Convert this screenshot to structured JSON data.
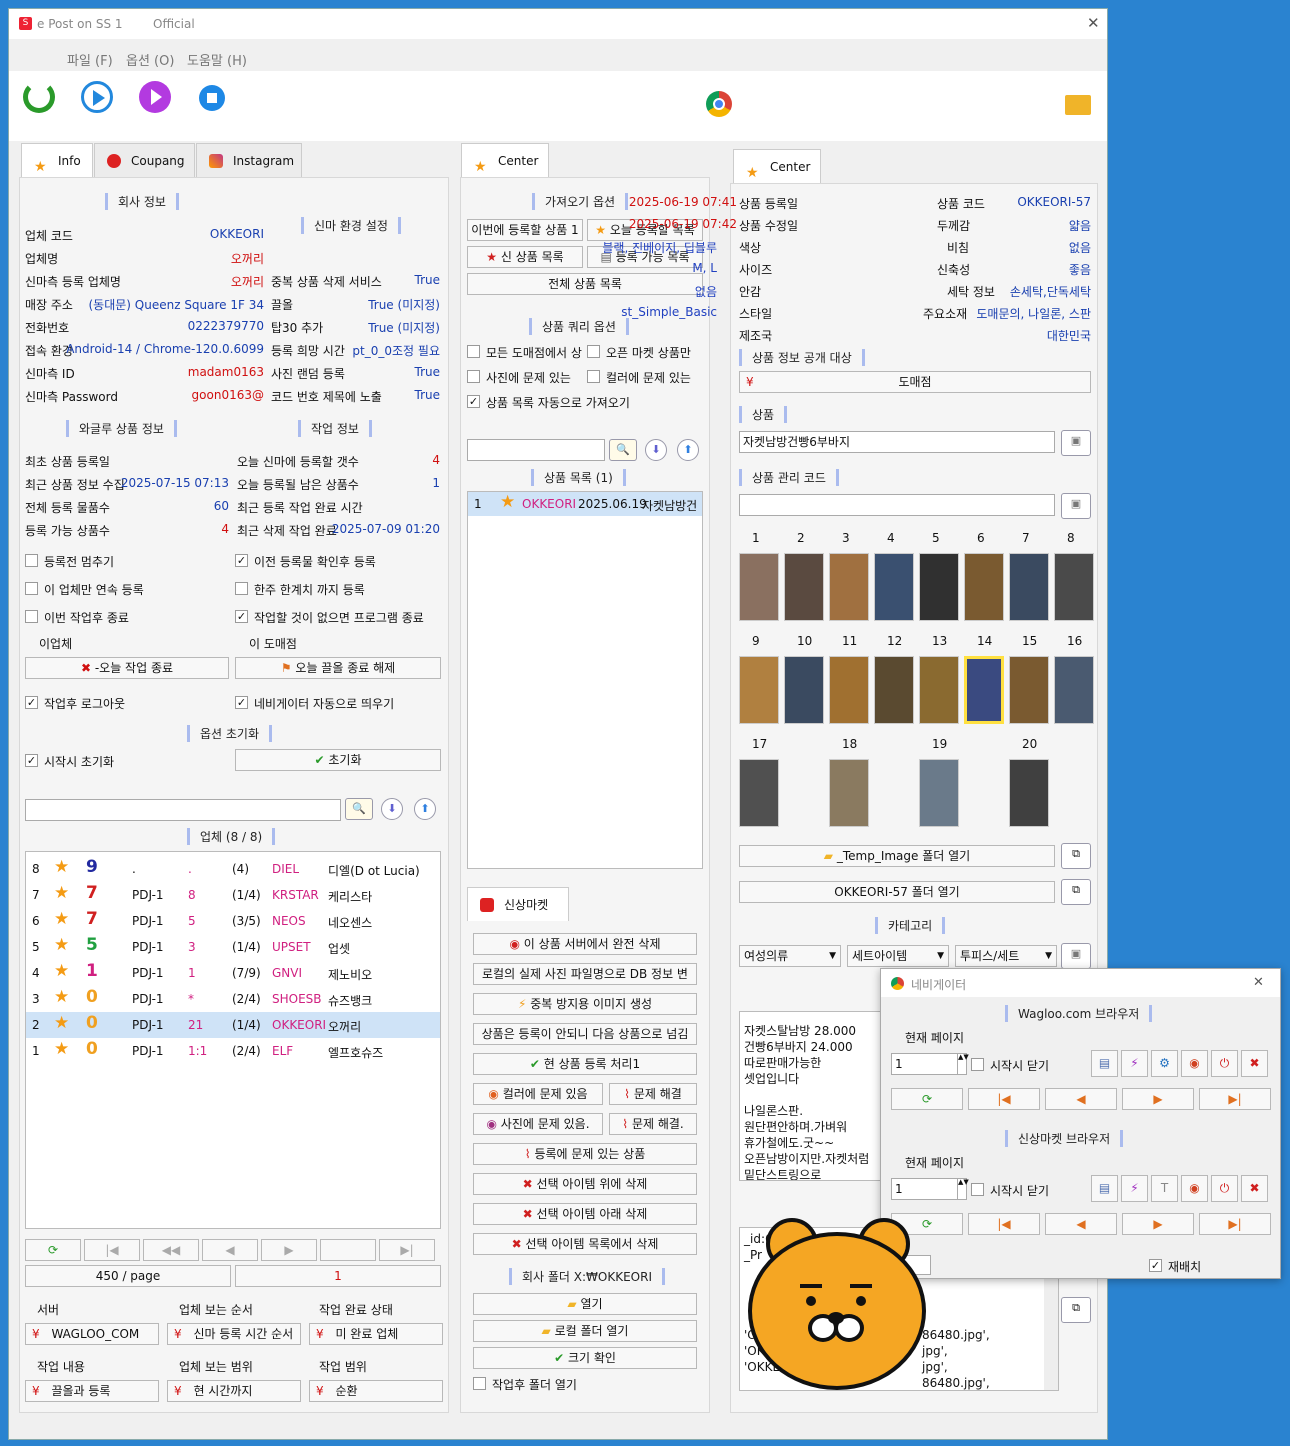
{
  "window": {
    "title": "e Post on SS 1",
    "subtitle": "Official"
  },
  "menu": [
    "파일 (F)",
    "옵션 (O)",
    "도움말 (H)"
  ],
  "tabs_left": [
    "Info",
    "Coupang",
    "Instagram"
  ],
  "company": {
    "header": "회사 정보",
    "rows": [
      {
        "k": "업체 코드",
        "v": "OKKEORI"
      },
      {
        "k": "업체명",
        "v": "오꺼리"
      },
      {
        "k": "신마측 등록 업체명",
        "v": "오꺼리"
      },
      {
        "k": "매장 주소",
        "v": "(동대문) Queenz Square 1F 34"
      },
      {
        "k": "전화번호",
        "v": "0222379770"
      },
      {
        "k": "접속 환경",
        "v": "Android-14 / Chrome-120.0.6099"
      },
      {
        "k": "신마측 ID",
        "v": "madam0163"
      },
      {
        "k": "신마측 Password",
        "v": "goon0163@"
      }
    ]
  },
  "env": {
    "header": "신마 환경 설정",
    "rows": [
      {
        "k": "중복 상품 삭제 서비스",
        "v": "True"
      },
      {
        "k": "끌올",
        "v": "True (미지정)"
      },
      {
        "k": "탑30 추가",
        "v": "True (미지정)"
      },
      {
        "k": "등록 희망 시간",
        "v": "pt_0_0조정 필요"
      },
      {
        "k": "사진 랜덤 등록",
        "v": "True"
      },
      {
        "k": "코드 번호 제목에 노출",
        "v": "True"
      }
    ]
  },
  "wagle": {
    "header": "와글루 상품 정보",
    "rows": [
      {
        "k": "최초 상품 등록일",
        "v": ""
      },
      {
        "k": "최근 상품 정보 수집",
        "v": "2025-07-15 07:13"
      },
      {
        "k": "전체 등록 물품수",
        "v": "60"
      },
      {
        "k": "등록 가능 상품수",
        "v": "4"
      }
    ]
  },
  "work": {
    "header": "작업 정보",
    "rows": [
      {
        "k": "오늘 신마에 등록할 갯수",
        "v": "4"
      },
      {
        "k": "오늘 등록될 남은 상품수",
        "v": "1"
      },
      {
        "k": "최근 등록 작업 완료 시간",
        "v": ""
      },
      {
        "k": "최근 삭제 작업 완료",
        "v": "2025-07-09 01:20"
      }
    ]
  },
  "opts": {
    "c1": "등록전 멈추기",
    "c2": "이전 등록물 확인후 등록",
    "c3": "이 업체만 연속 등록",
    "c4": "한주 한계치 까지 등록",
    "c5": "이번 작업후 종료",
    "c6": "작업할 것이 없으면 프로그램 종료",
    "l1": "이업체",
    "l2": "이 도매점",
    "b1": "-오늘 작업 종료",
    "b2": "오늘 끌올 종료 해제",
    "c7": "작업후 로그아웃",
    "c8": "네비게이터 자동으로 띄우기",
    "init_header": "옵션 초기화",
    "c9": "시작시 초기화",
    "b3": "초기화"
  },
  "vendors": {
    "header": "업체 (8 / 8)",
    "rows": [
      {
        "n": "8",
        "s": "9",
        "c": "#222aa0",
        "p": ".",
        "d": ".",
        "r": "(4)",
        "code": "DIEL",
        "name": "디엘(D ot Lucia)"
      },
      {
        "n": "7",
        "s": "7",
        "c": "#d02020",
        "p": "PDJ-1",
        "d": "8",
        "r": "(1/4)",
        "code": "KRSTAR",
        "name": "케리스타"
      },
      {
        "n": "6",
        "s": "7",
        "c": "#d02020",
        "p": "PDJ-1",
        "d": "5",
        "r": "(3/5)",
        "code": "NEOS",
        "name": "네오센스"
      },
      {
        "n": "5",
        "s": "5",
        "c": "#20a040",
        "p": "PDJ-1",
        "d": "3",
        "r": "(1/4)",
        "code": "UPSET",
        "name": "업셋"
      },
      {
        "n": "4",
        "s": "1",
        "c": "#d02080",
        "p": "PDJ-1",
        "d": "1",
        "r": "(7/9)",
        "code": "GNVI",
        "name": "제노비오"
      },
      {
        "n": "3",
        "s": "0",
        "c": "#f0a020",
        "p": "PDJ-1",
        "d": "*",
        "r": "(2/4)",
        "code": "SHOESB",
        "name": "슈즈뱅크"
      },
      {
        "n": "2",
        "s": "0",
        "c": "#f0a020",
        "p": "PDJ-1",
        "d": "21",
        "r": "(1/4)",
        "code": "OKKEORI",
        "name": "오꺼리"
      },
      {
        "n": "1",
        "s": "0",
        "c": "#f0a020",
        "p": "PDJ-1",
        "d": "1:1",
        "r": "(2/4)",
        "code": "ELF",
        "name": "엘프호슈즈"
      }
    ]
  },
  "paging": {
    "per": "450 / page",
    "page": "1"
  },
  "bottom": {
    "l1": "서버",
    "l2": "업체 보는 순서",
    "l3": "작업 완료 상태",
    "v1": "WAGLOO_COM",
    "v2": "신마 등록 시간 순서",
    "v3": "미 완료 업체",
    "l4": "작업 내용",
    "l5": "업체 보는 범위",
    "l6": "작업 범위",
    "v4": "끌올과 등록",
    "v5": "현 시간까지",
    "v6": "순환"
  },
  "center": {
    "tab": "Center",
    "fetch_header": "가져오기 옵션",
    "b1": "이번에 등록할 상품 1",
    "b2": "오늘 등록할 목록",
    "b3": "신 상품 목록",
    "b4": "등록 가능 목록",
    "b5": "전체 상품 목록",
    "query_header": "상품 쿼리 옵션",
    "c1": "모든 도매점에서 상",
    "c2": "오픈 마켓 상품만",
    "c3": "사진에 문제 있는",
    "c4": "컬러에 문제 있는",
    "c5": "상품 목록 자동으로 가져오기",
    "list_header": "상품 목록 (1)",
    "item": {
      "n": "1",
      "code": "OKKEORI",
      "date": "2025.06.19",
      "name": "자켓남방건"
    },
    "sm_tab": "신상마켓",
    "sm": [
      "이 상품 서버에서 완전 삭제",
      "로컬의 실제 사진 파일명으로 DB 정보 변",
      "중복 방지용 이미지 생성",
      "상품은 등록이 안되니 다음 상품으로 넘김",
      "현 상품 등록 처리1",
      "컬러에 문제 있음",
      "문제 해결",
      "사진에 문제 있음.",
      "문제 해결.",
      "등록에 문제 있는 상품",
      "선택 아이템 위에 삭제",
      "선택 아이템 아래 삭제",
      "선택 아이템 목록에서 삭제"
    ],
    "folder_header": "회사 폴더 X:₩OKKEORI",
    "f1": "열기",
    "f2": "로컬 폴더 열기",
    "f3": "크기 확인",
    "f4": "작업후 폴더 열기"
  },
  "right": {
    "tab": "Center",
    "rows": [
      {
        "k": "상품 등록일",
        "v": "2025-06-19 07:41",
        "k2": "상품 코드",
        "v2": "OKKEORI-57"
      },
      {
        "k": "상품 수정일",
        "v": "2025-06-19 07:42",
        "k2": "두께감",
        "v2": "얇음"
      },
      {
        "k": "색상",
        "v": "블랙, 진베이지, 딥블루",
        "k2": "비침",
        "v2": "없음"
      },
      {
        "k": "사이즈",
        "v": "M, L",
        "k2": "신축성",
        "v2": "좋음"
      },
      {
        "k": "안감",
        "v": "없음",
        "k2": "세탁 정보",
        "v2": "손세탁,단독세탁"
      },
      {
        "k": "스타일",
        "v": "st_Simple_Basic",
        "k2": "주요소재",
        "v2": "도매문의, 나일론, 스판"
      },
      {
        "k": "제조국",
        "v": "",
        "k2": "",
        "v2": "대한민국"
      }
    ],
    "public_header": "상품 정보 공개 대상",
    "public": "도매점",
    "prod_header": "상품",
    "prod": "자켓남방건빵6부바지",
    "mgmt_header": "상품 관리 코드",
    "imgnums": [
      "1",
      "2",
      "3",
      "4",
      "5",
      "6",
      "7",
      "8",
      "9",
      "10",
      "11",
      "12",
      "13",
      "14",
      "15",
      "16",
      "17",
      "18",
      "19",
      "20"
    ],
    "temp_btn": "_Temp_Image 폴더 열기",
    "folder_btn": "OKKEORI-57 폴더 열기",
    "cat_header": "카테고리",
    "cat1": "여성의류",
    "cat2": "세트아이템",
    "cat3": "투피스/세트",
    "desc": [
      "자켓스탈남방 28.000",
      "건빵6부바지 24.000",
      "따로판매가능한",
      "셋업입니다",
      "",
      "나일론스판.",
      "원단편안하며.가벼워",
      "휴가철에도.굿~~",
      "오픈남방이지만.자켓처럼",
      "밑단스트링으로"
    ],
    "files": [
      "_id:6",
      "_Pr",
      "",
      "",
      "",
      "",
      "'O",
      "'OKK",
      "'OKKEORI-"
    ],
    "files_r": [
      "86480.jpg',",
      "jpg',",
      "jpg',",
      "86480.jpg',"
    ]
  },
  "nav": {
    "title": "네비게이터",
    "h1": "Wagloo.com 브라우저",
    "lp1": "현재 페이지",
    "v1": "1",
    "c1": "시작시 닫기",
    "h2": "신상마켓 브라우저",
    "lp2": "현재 페이지",
    "v2": "1",
    "c2": "시작시 닫기",
    "re": "재배치",
    "b": "B"
  }
}
